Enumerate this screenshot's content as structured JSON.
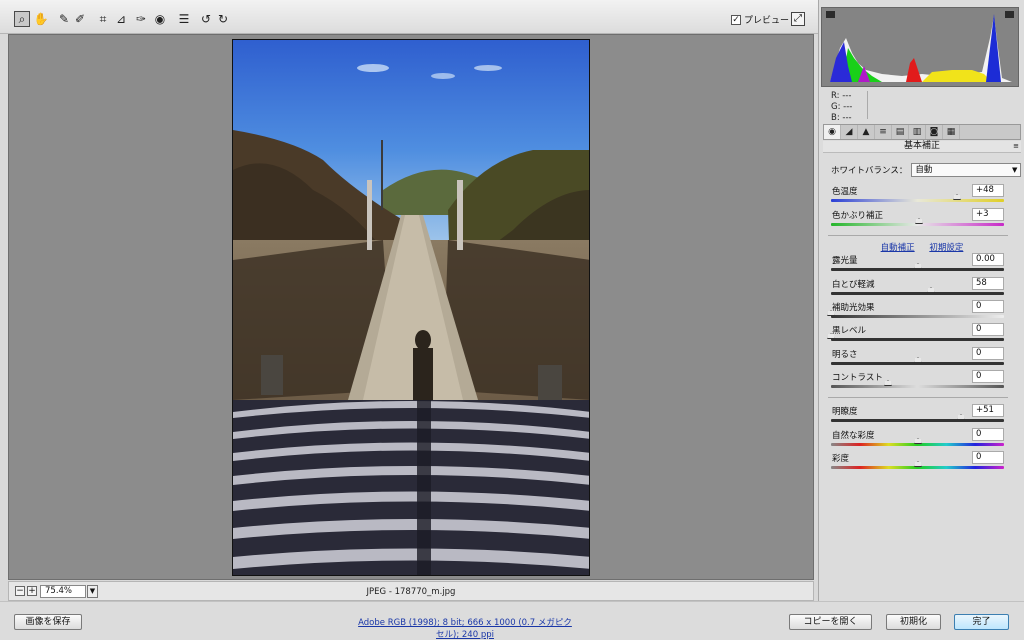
{
  "toolbar": {
    "tools": [
      {
        "name": "zoom-tool",
        "icon": "magnifier-icon",
        "glyph": "⌕",
        "active": true
      },
      {
        "name": "hand-tool",
        "icon": "hand-icon",
        "glyph": "✋"
      },
      {
        "name": "white-balance-tool",
        "icon": "eyedropper-icon",
        "glyph": "✎"
      },
      {
        "name": "color-sampler-tool",
        "icon": "eyedropper-plus-icon",
        "glyph": "✐"
      },
      {
        "name": "crop-tool",
        "icon": "crop-icon",
        "glyph": "⌗"
      },
      {
        "name": "straighten-tool",
        "icon": "straighten-icon",
        "glyph": "⊿"
      },
      {
        "name": "retouch-tool",
        "icon": "brush-icon",
        "glyph": "✑"
      },
      {
        "name": "red-eye-tool",
        "icon": "eye-icon",
        "glyph": "◉"
      },
      {
        "name": "preferences-tool",
        "icon": "list-icon",
        "glyph": "☰"
      },
      {
        "name": "rotate-left-tool",
        "icon": "rotate-ccw-icon",
        "glyph": "↺"
      },
      {
        "name": "rotate-right-tool",
        "icon": "rotate-cw-icon",
        "glyph": "↻"
      }
    ],
    "preview_label": "プレビュー",
    "preview_checked": true
  },
  "canvas": {
    "zoom": "75.4%",
    "filename": "JPEG  -  178770_m.jpg"
  },
  "histogram": {
    "r": "R:  ---",
    "g": "G:  ---",
    "b": "B:  ---"
  },
  "panel": {
    "section_title": "基本補正",
    "white_balance_label": "ホワイトバランス：",
    "white_balance_value": "自動",
    "auto_label": "自動補正",
    "default_label": "初期設定",
    "sliders": [
      {
        "label": "色温度",
        "value": "+48",
        "pos": 0.73,
        "track": "temp"
      },
      {
        "label": "色かぶり補正",
        "value": "+3",
        "pos": 0.51,
        "track": "tint"
      },
      {
        "label": "露光量",
        "value": "0.00",
        "pos": 0.5,
        "track": "dark"
      },
      {
        "label": "白とび軽減",
        "value": "58",
        "pos": 0.58,
        "track": "dark"
      },
      {
        "label": "補助光効果",
        "value": "0",
        "pos": 0.0,
        "track": "light"
      },
      {
        "label": "黒レベル",
        "value": "0",
        "pos": 0.0,
        "track": "dark"
      },
      {
        "label": "明るさ",
        "value": "0",
        "pos": 0.5,
        "track": "dark"
      },
      {
        "label": "コントラスト",
        "value": "0",
        "pos": 0.33,
        "track": "contrast"
      },
      {
        "label": "明瞭度",
        "value": "+51",
        "pos": 0.75,
        "track": "dark"
      },
      {
        "label": "自然な彩度",
        "value": "0",
        "pos": 0.5,
        "track": "rainbow"
      },
      {
        "label": "彩度",
        "value": "0",
        "pos": 0.5,
        "track": "rainbow"
      }
    ]
  },
  "bottom": {
    "save_label": "画像を保存",
    "workflow_label": "Adobe RGB (1998); 8 bit; 666 x 1000 (0.7 メガピクセル); 240 ppi",
    "open_copy_label": "コピーを開く",
    "reset_label": "初期化",
    "done_label": "完了"
  },
  "colors": {
    "accent_link": "#1a37a8",
    "canvas_bg": "#8c8c8c",
    "panel_bg": "#dcdcdc"
  }
}
